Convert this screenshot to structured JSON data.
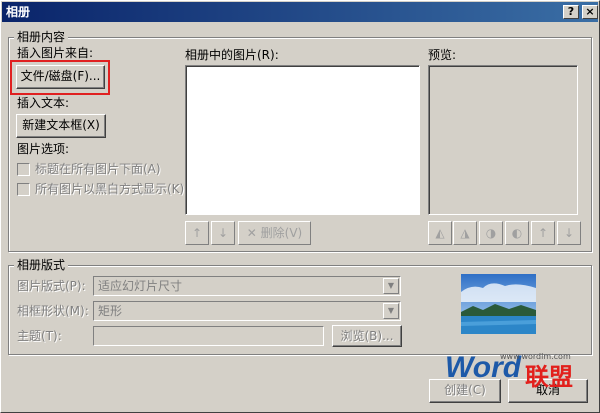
{
  "window": {
    "title": "相册",
    "help_label": "?",
    "close_label": "×"
  },
  "content": {
    "group_title": "相册内容",
    "insert_from_label": "插入图片来自:",
    "file_disk_button": "文件/磁盘(F)...",
    "insert_text_label": "插入文本:",
    "new_textbox_button": "新建文本框(X)",
    "picture_options_label": "图片选项:",
    "caption_below_label": "标题在所有图片下面(A)",
    "all_bw_label": "所有图片以黑白方式显示(K)",
    "pictures_in_album_label": "相册中的图片(R):",
    "preview_label": "预览:",
    "move_up_label": "↑",
    "move_down_label": "↓",
    "remove_label": "删除(V)",
    "rotate_icons": [
      "rotate-left-icon",
      "rotate-right-icon",
      "contrast-up-icon",
      "contrast-down-icon",
      "brightness-up-icon",
      "brightness-down-icon"
    ]
  },
  "layout": {
    "group_title": "相册版式",
    "picture_layout_label": "图片版式(P):",
    "picture_layout_value": "适应幻灯片尺寸",
    "frame_shape_label": "相框形状(M):",
    "frame_shape_value": "矩形",
    "theme_label": "主题(T):",
    "theme_value": "",
    "browse_button": "浏览(B)..."
  },
  "footer": {
    "create_button": "创建(C)",
    "cancel_button": "取消"
  },
  "watermark": {
    "brand_latin": "Word",
    "brand_cn": "联盟",
    "url": "www.wordlm.com"
  },
  "colors": {
    "titlebar": "#0a246a",
    "highlight": "#e02020",
    "face": "#d4d0c8"
  }
}
